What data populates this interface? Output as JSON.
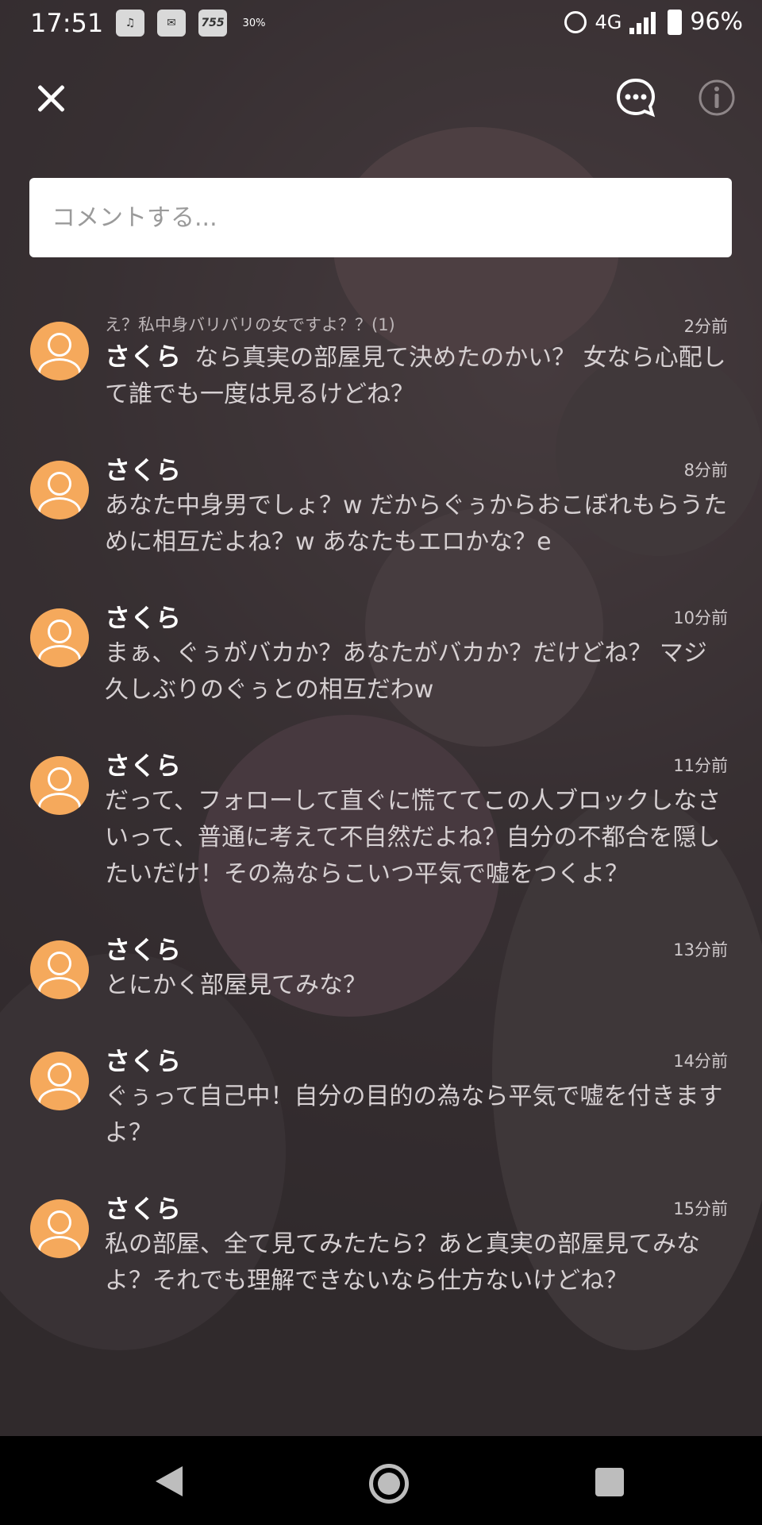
{
  "status_bar": {
    "time": "17:51",
    "left_icons": [
      "headset-icon",
      "mail-icon",
      "app-icon-755",
      "cloud-30-icon"
    ],
    "app_icon_label": "755",
    "cloud_label": "30%",
    "network": "4G",
    "battery": "96%"
  },
  "header": {
    "close_icon": "close-icon",
    "chat_icon": "chat-bubble-icon",
    "info_icon": "info-icon"
  },
  "comment_input": {
    "placeholder": "コメントする..."
  },
  "comments": [
    {
      "reply_to": "え？私中身バリバリの女ですよ？？(1)",
      "name": "さくら",
      "time": "2分前",
      "text": "なら真実の部屋見て決めたのかい？ 女なら心配して誰でも一度は見るけどね？"
    },
    {
      "name": "さくら",
      "time": "8分前",
      "text": "あなた中身男でしょ？w だからぐぅからおこぼれもらうために相互だよね？w あなたもエロかな？e"
    },
    {
      "name": "さくら",
      "time": "10分前",
      "text": "まぁ、ぐぅがバカか？あなたがバカか？だけどね？ マジ久しぶりのぐぅとの相互だわw"
    },
    {
      "name": "さくら",
      "time": "11分前",
      "text": "だって、フォローして直ぐに慌ててこの人ブロックしなさいって、普通に考えて不自然だよね？自分の不都合を隠したいだけ！その為ならこいつ平気で嘘をつくよ？"
    },
    {
      "name": "さくら",
      "time": "13分前",
      "text": "とにかく部屋見てみな？"
    },
    {
      "name": "さくら",
      "time": "14分前",
      "text": "ぐぅって自己中！自分の目的の為なら平気で嘘を付きますよ？"
    },
    {
      "name": "さくら",
      "time": "15分前",
      "text": "私の部屋、全て見てみたたら？あと真実の部屋見てみなよ？それでも理解できないなら仕方ないけどね？"
    }
  ],
  "nav_bar": {
    "back_icon": "back-triangle-icon",
    "home_icon": "home-circle-icon",
    "recents_icon": "recents-square-icon"
  },
  "colors": {
    "avatar": "#f5a95c",
    "overlay": "#3c3639",
    "text_primary": "#ffffff",
    "text_secondary": "#d6d0d2"
  }
}
